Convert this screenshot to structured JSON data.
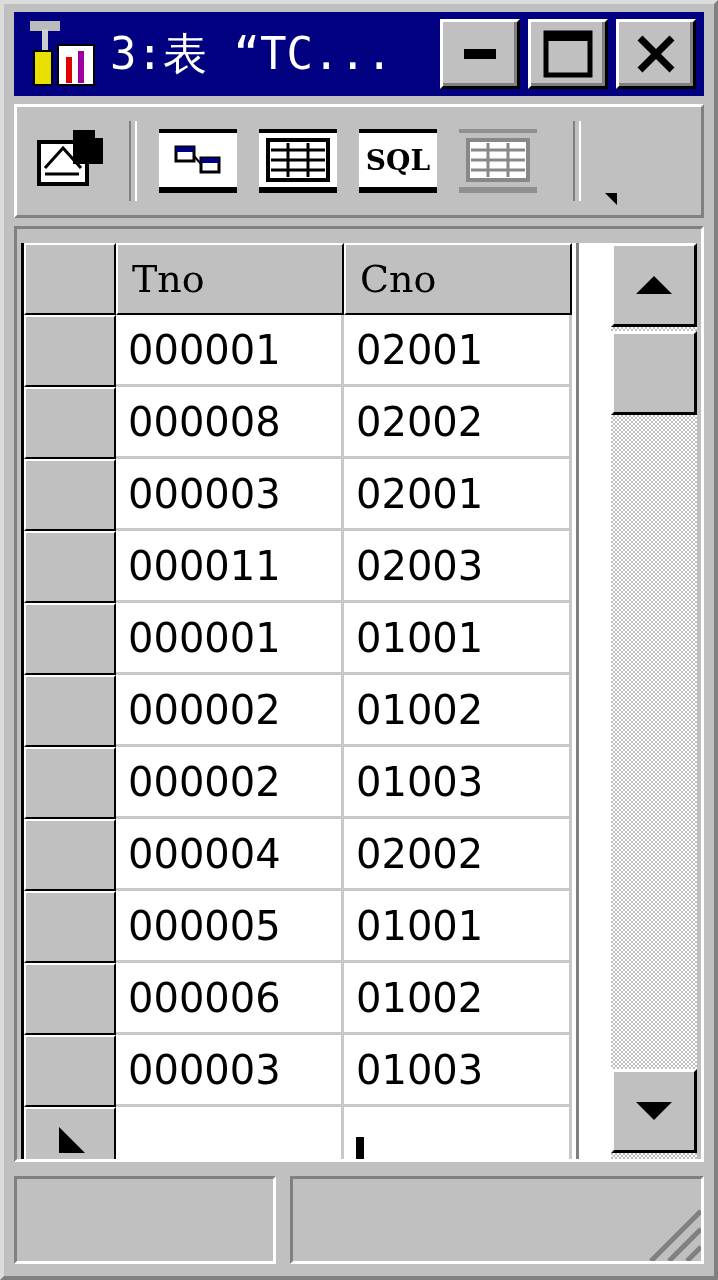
{
  "window": {
    "title": "3:表 “TC..."
  },
  "toolbar": [
    {
      "kind": "properties",
      "disabled": false
    },
    {
      "kind": "diagram",
      "disabled": false
    },
    {
      "kind": "grid",
      "disabled": false
    },
    {
      "kind": "sql",
      "label": "SQL",
      "disabled": false
    },
    {
      "kind": "results",
      "disabled": true
    }
  ],
  "table": {
    "columns": [
      "Tno",
      "Cno"
    ],
    "rows": [
      [
        "000001",
        "02001"
      ],
      [
        "000008",
        "02002"
      ],
      [
        "000003",
        "02001"
      ],
      [
        "000011",
        "02003"
      ],
      [
        "000001",
        "01001"
      ],
      [
        "000002",
        "01002"
      ],
      [
        "000002",
        "01003"
      ],
      [
        "000004",
        "02002"
      ],
      [
        "000005",
        "01001"
      ],
      [
        "000006",
        "01002"
      ],
      [
        "000003",
        "01003"
      ]
    ]
  }
}
